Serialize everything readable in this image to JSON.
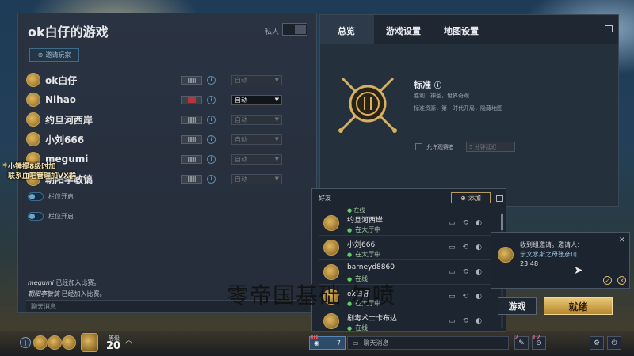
{
  "lobby": {
    "title": "ok白仔的游戏",
    "private_label": "私人",
    "invite_button": "邀请玩家",
    "players": [
      {
        "name": "ok白仔",
        "flag": "grid-flag",
        "team": "自动",
        "active": false
      },
      {
        "name": "Nihao",
        "flag": "red-flag",
        "team": "自动",
        "active": true
      },
      {
        "name": "约旦河西岸",
        "flag": "grid-flag",
        "team": "自动",
        "active": false
      },
      {
        "name": "小刘666",
        "flag": "grid-flag",
        "team": "自动",
        "active": false
      },
      {
        "name": "megumi",
        "flag": "grid-flag",
        "team": "自动",
        "active": false
      },
      {
        "name": "朝阳李敏镐",
        "flag": "grid-flag",
        "team": "自动",
        "active": false
      }
    ],
    "slots": [
      "栏位开启",
      "栏位开启"
    ],
    "chat_log": [
      {
        "who": "megumi",
        "text": "已经加入比赛。"
      },
      {
        "who": "朝阳李敏镐",
        "text": "已经加入比赛。"
      }
    ],
    "chat_placeholder": "聊天消息"
  },
  "settings": {
    "tabs": [
      "总览",
      "游戏设置",
      "地图设置"
    ],
    "mode_name": "标准",
    "mode_desc1": "胜利：神圣，世界奇观",
    "mode_desc2": "标准资源，第一时代开局，隐藏地图",
    "spectator_label": "允许观赛者",
    "spectator_value": "5 分钟延迟"
  },
  "friends": {
    "title": "好友",
    "add_label": "添加",
    "list": [
      {
        "name": "约旦河西岸",
        "status": "在大厅中"
      },
      {
        "name": "小刘666",
        "status": "在大厅中"
      },
      {
        "name": "barneyd8860",
        "status": "在线"
      },
      {
        "name": "ok白仔",
        "status": "在大厅中"
      },
      {
        "name": "剧毒术士卡布达",
        "status": "在线"
      }
    ],
    "top_status": "在线"
  },
  "invite": {
    "text": "收到组邀请。邀请人：",
    "inviter": "示文水斯之母张彦川",
    "time": "23:48"
  },
  "buttons": {
    "leave": "游戏",
    "ready": "就绪"
  },
  "bottom_bar": {
    "level_label": "等级",
    "level": "20",
    "friends_count": "7",
    "friends_badge": "30",
    "chat_placeholder": "聊天消息",
    "notif_badge_1": "2",
    "notif_badge_2": "12"
  },
  "overlay": {
    "streamer_line1": "小锤提8级时加",
    "streamer_line2": "联系血吧管理加VX群",
    "watermark": "零帝国基础 勿喷"
  },
  "colors": {
    "accent_gold": "#e7c774",
    "online_green": "#5fd05f",
    "panel_bg": "#2a3342",
    "alert_red": "#ff5555"
  }
}
